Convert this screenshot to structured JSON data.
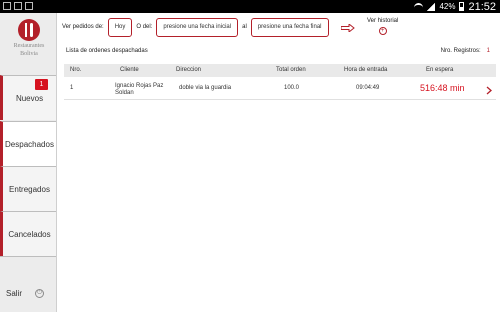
{
  "statusbar": {
    "battery": "42%",
    "time": "21:52"
  },
  "sidebar": {
    "logo_line1": "Restaurantes",
    "logo_line2": "Bolivia",
    "items": [
      {
        "label": "Nuevos",
        "badge": "1"
      },
      {
        "label": "Despachados"
      },
      {
        "label": "Entregados"
      },
      {
        "label": "Cancelados"
      }
    ],
    "exit_label": "Salir"
  },
  "filter": {
    "view_label": "Ver pedidos de:",
    "today_button": "Hoy",
    "from_label": "O del:",
    "start_date_placeholder": "presione una fecha inicial",
    "to_label": "al",
    "end_date_placeholder": "presione una fecha final",
    "history_label": "Ver historial"
  },
  "list": {
    "title": "Lista de ordenes despachadas",
    "records_label": "Nro. Registros:",
    "records_count": "1"
  },
  "table": {
    "headers": [
      "Nro.",
      "Cliente",
      "Direccion",
      "Total orden",
      "Hora de entrada",
      "En espera"
    ],
    "rows": [
      {
        "nro": "1",
        "cliente": "Ignacio Rojas Paz Soldan",
        "direccion": "doble via la guardia",
        "total": "100.0",
        "hora": "09:04:49",
        "espera": "516:48 min"
      }
    ]
  }
}
